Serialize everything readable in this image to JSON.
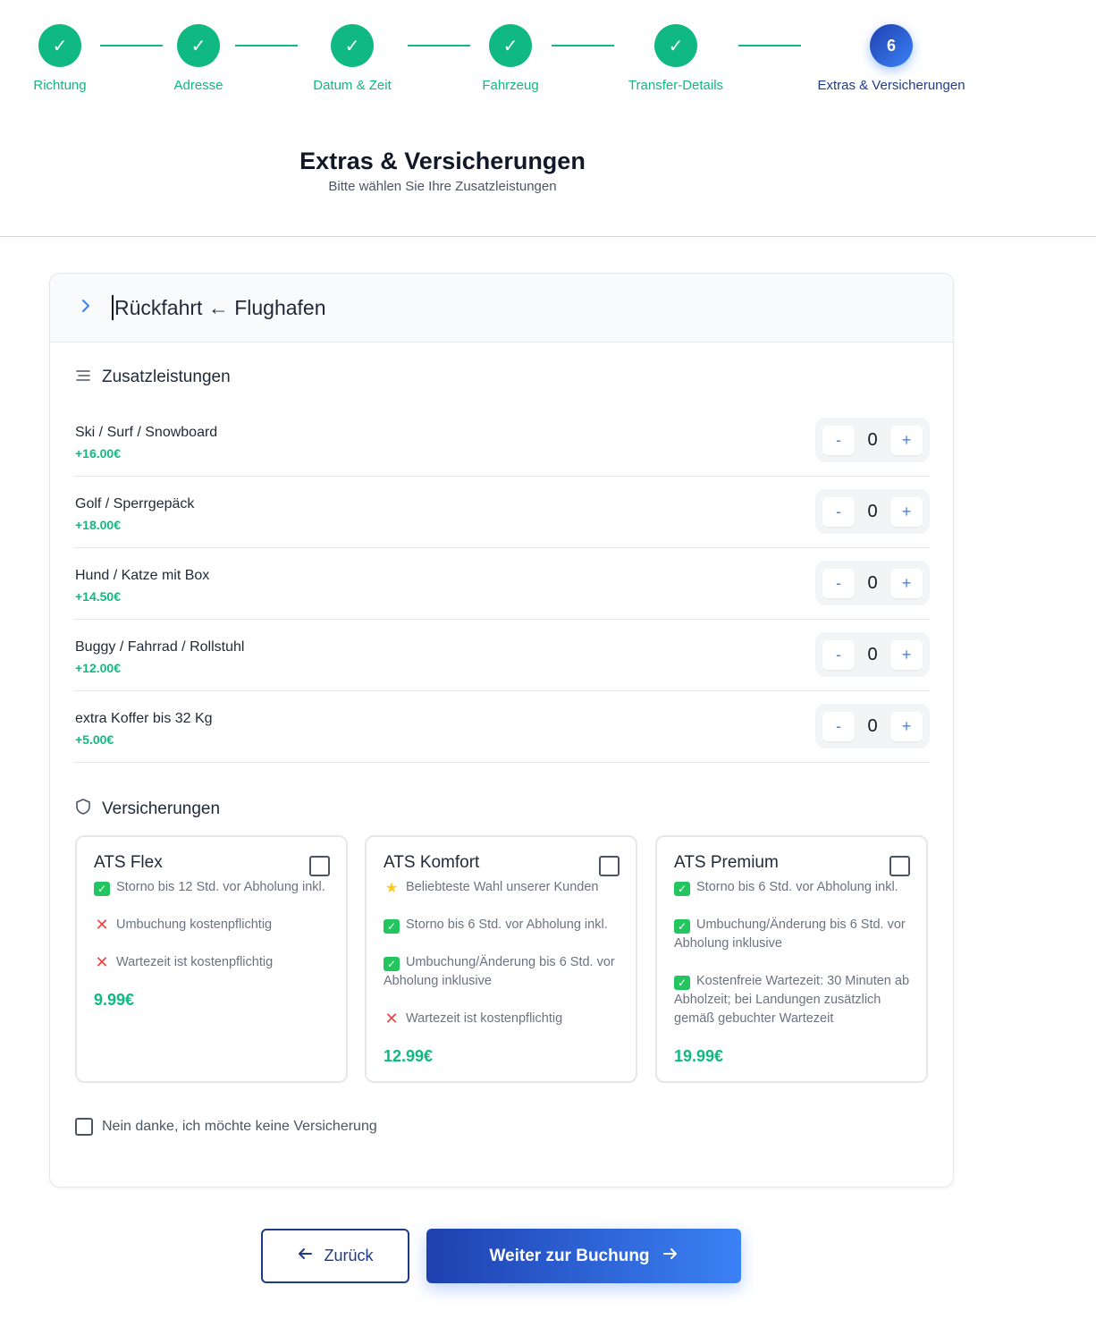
{
  "stepper": {
    "steps": [
      {
        "label": "Richtung",
        "marker": "✓"
      },
      {
        "label": "Adresse",
        "marker": "✓"
      },
      {
        "label": "Datum & Zeit",
        "marker": "✓"
      },
      {
        "label": "Fahrzeug",
        "marker": "✓"
      },
      {
        "label": "Transfer-Details",
        "marker": "✓"
      },
      {
        "label": "Extras & Versicherungen",
        "marker": "6"
      }
    ],
    "current_step": 6
  },
  "page": {
    "title": "Extras & Versicherungen",
    "subtitle": "Bitte wählen Sie Ihre Zusatzleistungen"
  },
  "card": {
    "header_title": "Rückfahrt ← Flughafen",
    "extras_heading": "Zusatzleistungen",
    "extras": [
      {
        "name": "Ski / Surf / Snowboard",
        "price": "+16.00€",
        "qty": "0"
      },
      {
        "name": "Golf / Sperrgepäck",
        "price": "+18.00€",
        "qty": "0"
      },
      {
        "name": "Hund / Katze mit Box",
        "price": "+14.50€",
        "qty": "0"
      },
      {
        "name": "Buggy / Fahrrad / Rollstuhl",
        "price": "+12.00€",
        "qty": "0"
      },
      {
        "name": "extra Koffer bis 32 Kg",
        "price": "+5.00€",
        "qty": "0"
      }
    ],
    "stepper_minus": "-",
    "stepper_plus": "+",
    "insurance_heading": "Versicherungen",
    "insurances": [
      {
        "name": "ATS Flex",
        "checked": false,
        "features": [
          {
            "type": "ok",
            "text": "Storno bis 12 Std. vor Abholung inkl."
          },
          {
            "type": "no",
            "text": "Umbuchung kostenpflichtig"
          },
          {
            "type": "no",
            "text": "Wartezeit ist kostenpflichtig"
          }
        ],
        "price": "9.99€"
      },
      {
        "name": "ATS Komfort",
        "checked": false,
        "features": [
          {
            "type": "star",
            "text": "Beliebteste Wahl unserer Kunden"
          },
          {
            "type": "ok",
            "text": "Storno bis 6 Std. vor Abholung inkl."
          },
          {
            "type": "ok",
            "text": "Umbuchung/Änderung bis 6 Std. vor Abholung inklusive"
          },
          {
            "type": "no",
            "text": "Wartezeit ist kostenpflichtig"
          }
        ],
        "price": "12.99€"
      },
      {
        "name": "ATS Premium",
        "checked": false,
        "features": [
          {
            "type": "ok",
            "text": "Storno bis 6 Std. vor Abholung inkl."
          },
          {
            "type": "ok",
            "text": "Umbuchung/Änderung bis 6 Std. vor Abholung inklusive"
          },
          {
            "type": "ok",
            "text": "Kostenfreie Wartezeit: 30 Minuten ab Abholzeit; bei Landungen zusätzlich gemäß gebuchter Wartezeit"
          }
        ],
        "price": "19.99€"
      }
    ],
    "no_insurance_label": "Nein danke, ich möchte keine Versicherung"
  },
  "actions": {
    "back_label": "Zurück",
    "next_label": "Weiter zur Buchung"
  },
  "colors": {
    "done": "#10b981",
    "active": "#1e40af",
    "accent": "#3b82f6",
    "price": "#10b981"
  },
  "icons": {
    "step_done": "check-icon",
    "header": "chevron-right-icon",
    "extras": "list-icon",
    "insurance": "shield-icon",
    "back": "arrow-left-icon",
    "next": "arrow-right-icon"
  }
}
